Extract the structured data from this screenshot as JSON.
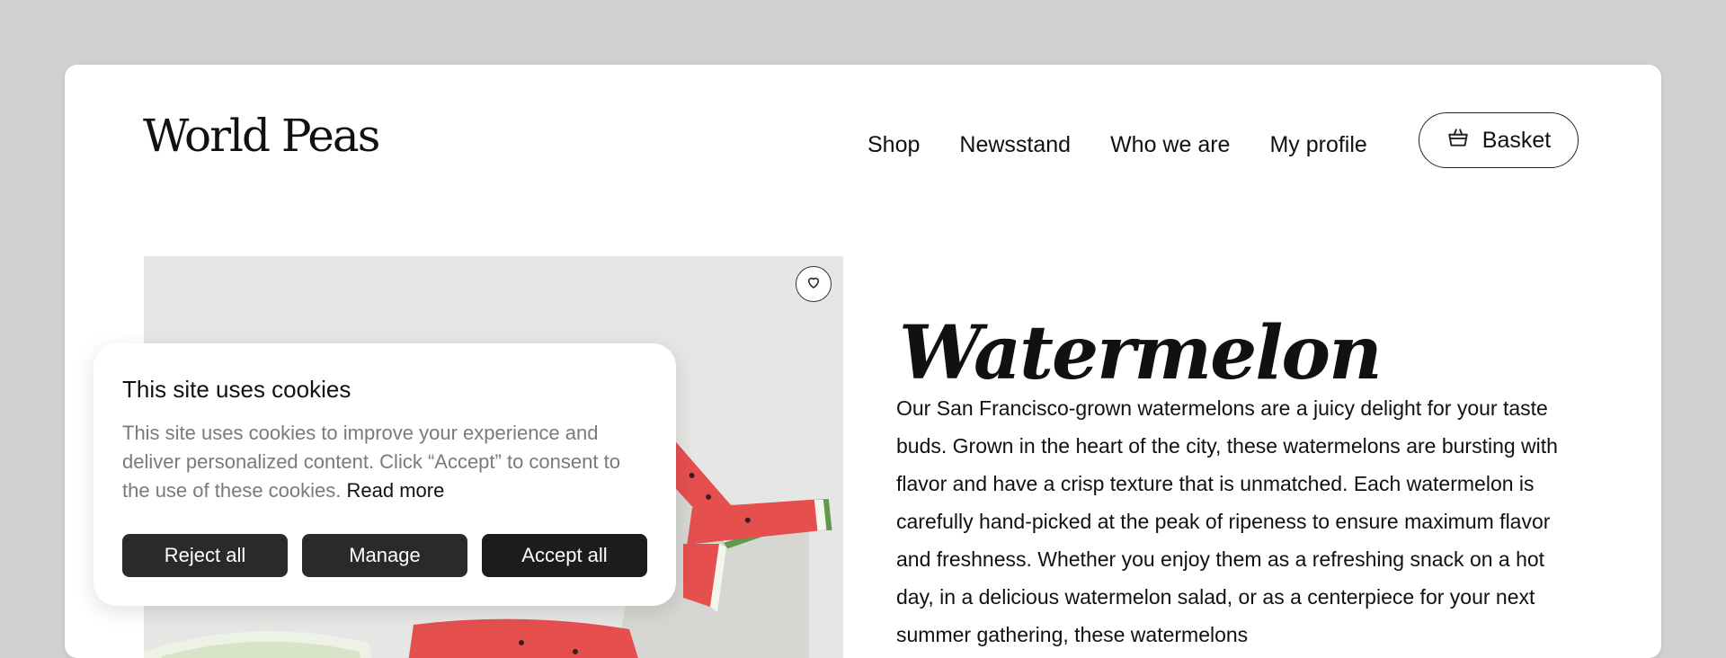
{
  "brand": {
    "name": "World Peas"
  },
  "nav": {
    "items": [
      "Shop",
      "Newsstand",
      "Who we are",
      "My profile"
    ],
    "basket_label": "Basket"
  },
  "product": {
    "title": "Watermelon",
    "description": "Our San Francisco-grown watermelons are a juicy delight for your taste buds. Grown in the heart of the city, these watermelons are bursting with flavor and have a crisp texture that is unmatched. Each watermelon is carefully hand-picked at the peak of ripeness to ensure maximum flavor and freshness. Whether you enjoy them as a refreshing snack on a hot day, in a delicious watermelon salad, or as a centerpiece for your next summer gathering, these watermelons",
    "image_icon": "watermelon-slices",
    "favorite_icon": "heart-icon"
  },
  "cookie_banner": {
    "title": "This site uses cookies",
    "text": "This site uses cookies to improve your experience and deliver personalized content. Click “Accept” to consent to the use of these cookies.",
    "read_more": "Read more",
    "buttons": {
      "reject": "Reject all",
      "manage": "Manage",
      "accept": "Accept all"
    }
  },
  "colors": {
    "background": "#d0d0d0",
    "surface": "#ffffff",
    "text": "#111111",
    "muted": "#7a7a7a",
    "button_dark": "#2a2a2a",
    "melon_red": "#e5504f",
    "rind_green": "#5f9a4e"
  }
}
